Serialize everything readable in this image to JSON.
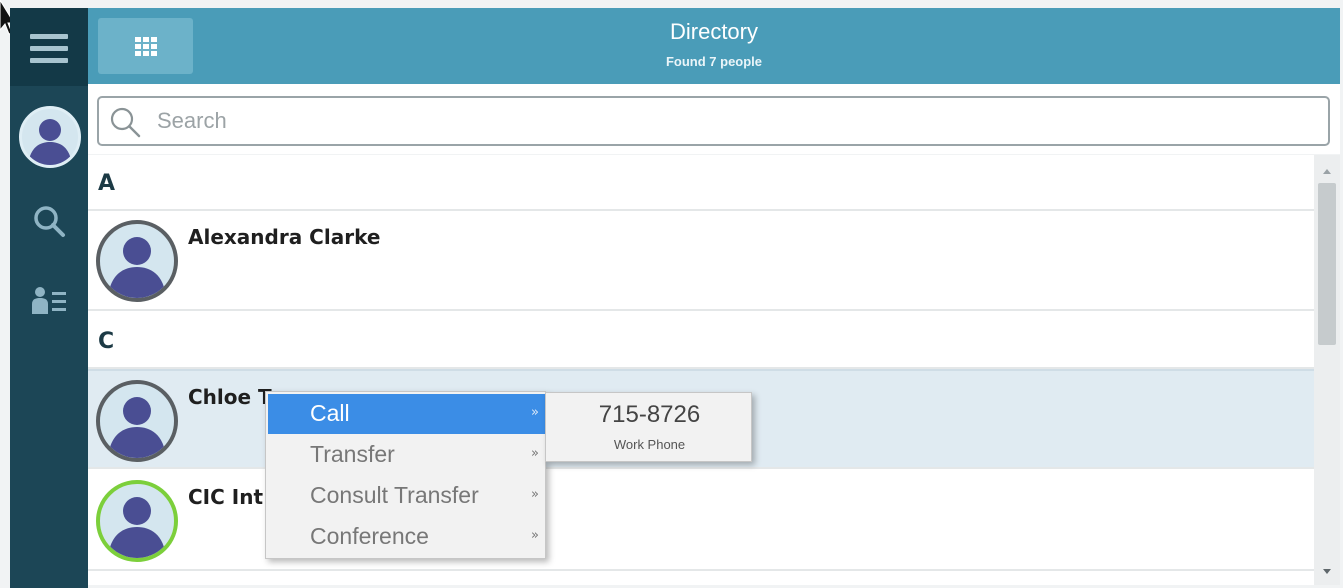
{
  "header": {
    "title": "Directory",
    "subtitle": "Found 7 people"
  },
  "search": {
    "placeholder": "Search",
    "value": ""
  },
  "sections": [
    {
      "letter": "A"
    },
    {
      "letter": "C"
    }
  ],
  "contacts": [
    {
      "name": "Alexandra Clarke",
      "status": "offline"
    },
    {
      "name": "Chloe T",
      "status": "offline",
      "selected": true
    },
    {
      "name": "CIC Int",
      "status": "available"
    }
  ],
  "context_menu": {
    "items": [
      {
        "label": "Call",
        "active": true,
        "arrow": "»"
      },
      {
        "label": "Transfer",
        "active": false,
        "arrow": "»"
      },
      {
        "label": "Consult Transfer",
        "active": false,
        "arrow": "»"
      },
      {
        "label": "Conference",
        "active": false,
        "arrow": "»"
      }
    ]
  },
  "submenu": {
    "number": "715-8726",
    "label": "Work Phone"
  },
  "colors": {
    "rail": "#1c4656",
    "header": "#4a9cb8",
    "menu_highlight": "#3b8de6",
    "available_ring": "#7ccf3b"
  }
}
